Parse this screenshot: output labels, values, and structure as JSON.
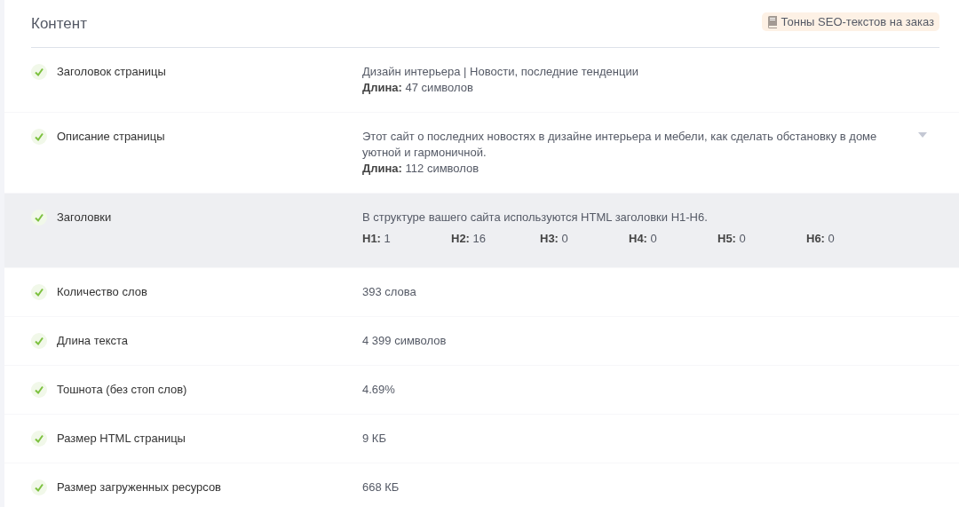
{
  "section": {
    "title": "Контент",
    "promo_link": "Тонны SEO-текстов на заказ"
  },
  "rows": [
    {
      "label": "Заголовок страницы",
      "passed": true,
      "highlighted": false,
      "expandable": false,
      "lines": [
        "Дизайн интерьера | Новости, последние тенденции",
        "**Длина:** 47 символов"
      ]
    },
    {
      "label": "Описание страницы",
      "passed": true,
      "highlighted": false,
      "expandable": true,
      "lines": [
        "Этот сайт о последних новостях в дизайне интерьера и мебели, как сделать обстановку в доме уютной и гармоничной.",
        "**Длина:** 112 символов"
      ]
    },
    {
      "label": "Заголовки",
      "passed": true,
      "highlighted": true,
      "expandable": false,
      "lines": [
        "В структуре вашего сайта используются HTML заголовки H1-H6."
      ],
      "headings": [
        "**H1:** 1",
        "**H2:** 16",
        "**H3:** 0",
        "**H4:** 0",
        "**H5:** 0",
        "**H6:** 0"
      ]
    },
    {
      "label": "Количество слов",
      "passed": true,
      "highlighted": false,
      "expandable": false,
      "lines": [
        "393 слова"
      ]
    },
    {
      "label": "Длина текста",
      "passed": true,
      "highlighted": false,
      "expandable": false,
      "lines": [
        "4 399 символов"
      ]
    },
    {
      "label": "Тошнота (без стоп слов)",
      "passed": true,
      "highlighted": false,
      "expandable": false,
      "lines": [
        "4.69%"
      ]
    },
    {
      "label": "Размер HTML страницы",
      "passed": true,
      "highlighted": false,
      "expandable": false,
      "lines": [
        "9 КБ"
      ]
    },
    {
      "label": "Размер загруженных ресурсов",
      "passed": true,
      "highlighted": false,
      "expandable": false,
      "lines": [
        "668 КБ"
      ]
    }
  ]
}
